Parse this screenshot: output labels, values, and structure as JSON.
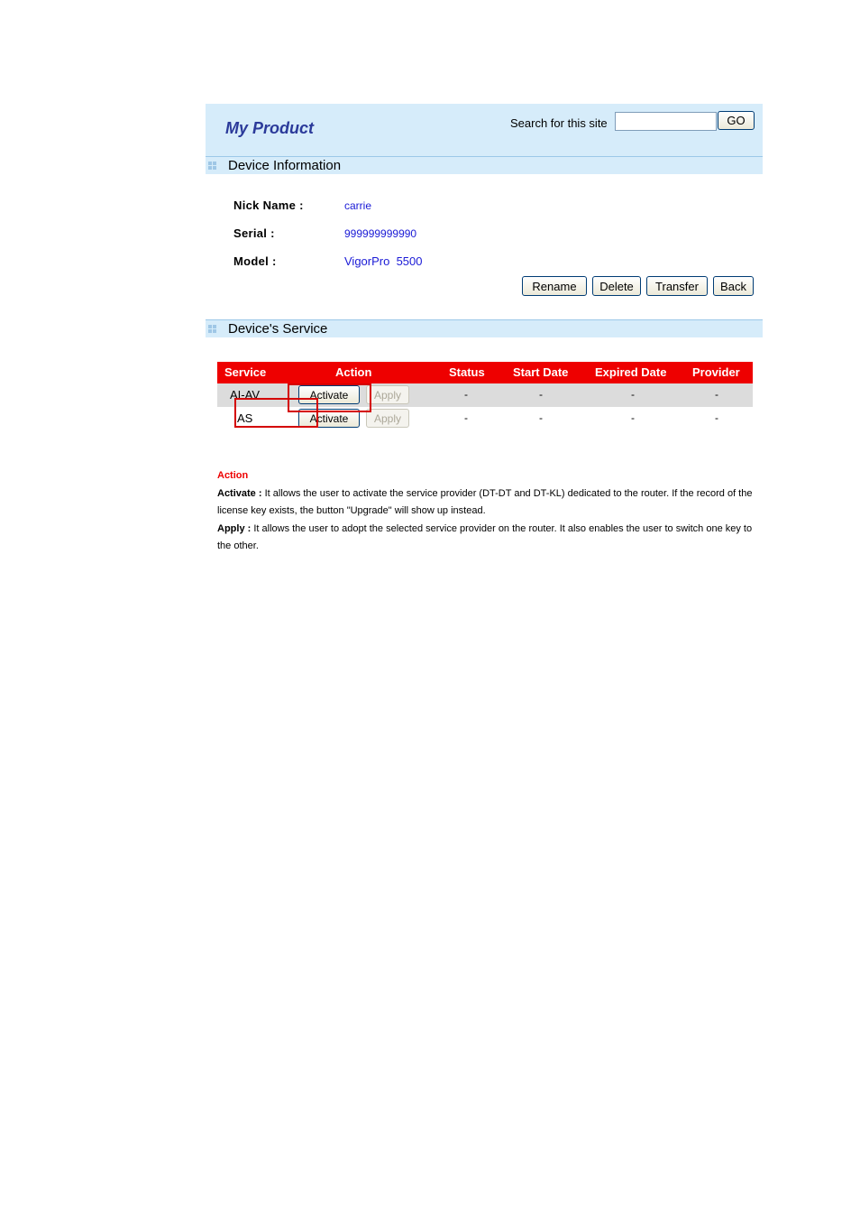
{
  "header": {
    "title": "My Product",
    "search_label": "Search for this site",
    "search_value": "",
    "go_label": "GO"
  },
  "device_info": {
    "section_title": "Device Information",
    "nick_label": "Nick Name :",
    "nick_value": "carrie",
    "serial_label": "Serial :",
    "serial_value": "999999999990",
    "model_label": "Model :",
    "model_value": "VigorPro  5500",
    "buttons": {
      "rename": "Rename",
      "delete": "Delete",
      "transfer": "Transfer",
      "back": "Back"
    }
  },
  "service": {
    "section_title": "Device's Service",
    "columns": [
      "Service",
      "Action",
      "Status",
      "Start Date",
      "Expired Date",
      "Provider"
    ],
    "rows": [
      {
        "service": "AI-AV",
        "activate": "Activate",
        "apply": "Apply",
        "status": "-",
        "start": "-",
        "expired": "-",
        "provider": "-"
      },
      {
        "service": "AS",
        "activate": "Activate",
        "apply": "Apply",
        "status": "-",
        "start": "-",
        "expired": "-",
        "provider": "-"
      }
    ]
  },
  "notes": {
    "heading": "Action",
    "activate_term": "Activate :",
    "activate_text": " It allows the user to activate the service provider (DT-DT and DT-KL) dedicated to the router. If the record of the license key exists, the button \"Upgrade\" will show up instead.",
    "apply_term": "Apply :",
    "apply_text": " It allows the user to adopt the selected service provider on the router. It also enables the user to switch one key to the other."
  },
  "colors": {
    "header_bg": "#d6ecfa",
    "title": "#2b3a9a",
    "table_header": "#ee0000",
    "value_blue": "#1a1ad6",
    "highlight": "#d40000"
  }
}
